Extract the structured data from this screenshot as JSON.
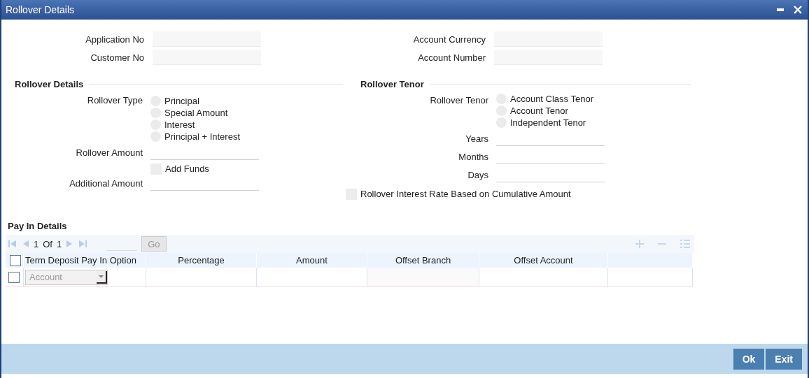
{
  "window": {
    "title": "Rollover Details"
  },
  "header_fields": {
    "left": [
      {
        "label": "Application No"
      },
      {
        "label": "Customer No"
      }
    ],
    "right": [
      {
        "label": "Account Currency"
      },
      {
        "label": "Account Number"
      }
    ]
  },
  "rollover_details": {
    "heading": "Rollover Details",
    "rollover_type": {
      "label": "Rollover Type",
      "options": [
        {
          "label": "Principal",
          "selected": false
        },
        {
          "label": "Special Amount",
          "selected": false
        },
        {
          "label": "Interest",
          "selected": false
        },
        {
          "label": "Principal + Interest",
          "selected": false
        }
      ]
    },
    "rollover_amount": {
      "label": "Rollover Amount"
    },
    "add_funds": {
      "label": "Add Funds",
      "checked": false
    },
    "additional_amount": {
      "label": "Additional Amount"
    }
  },
  "rollover_tenor": {
    "heading": "Rollover Tenor",
    "tenor": {
      "label": "Rollover Tenor",
      "options": [
        {
          "label": "Account Class Tenor",
          "selected": false
        },
        {
          "label": "Account Tenor",
          "selected": false
        },
        {
          "label": "Independent Tenor",
          "selected": false
        }
      ]
    },
    "fields": [
      {
        "label": "Years"
      },
      {
        "label": "Months"
      },
      {
        "label": "Days"
      }
    ],
    "cumulative": {
      "label": "Rollover Interest Rate Based on Cumulative Amount",
      "checked": false
    }
  },
  "pay_in": {
    "heading": "Pay In Details",
    "page": "1",
    "of": "Of",
    "total": "1",
    "go": "Go",
    "columns": [
      "Term Deposit Pay In Option",
      "Percentage",
      "Amount",
      "Offset Branch",
      "Offset Account"
    ],
    "header_checked": false,
    "rows": [
      {
        "checked": false,
        "option": "Account"
      }
    ]
  },
  "buttons": [
    "Ok",
    "Exit"
  ]
}
